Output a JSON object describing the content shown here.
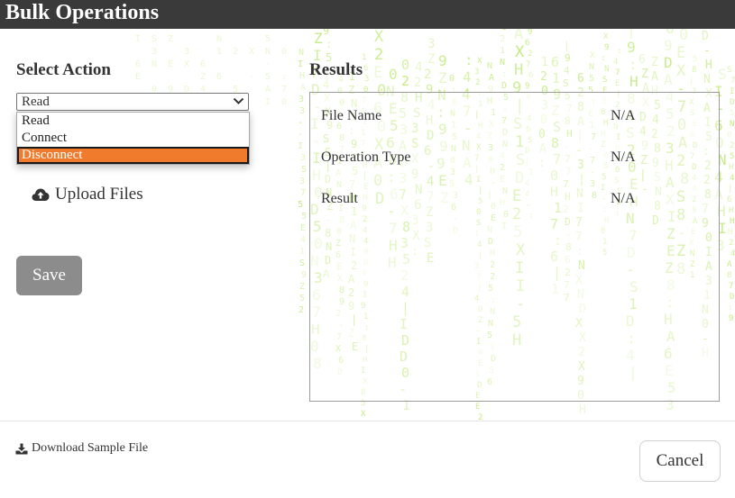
{
  "header": {
    "title": "Bulk Operations"
  },
  "select_action": {
    "heading": "Select Action",
    "selected_value": "Read",
    "options": [
      "Read",
      "Connect",
      "Disconnect"
    ],
    "highlighted_option": "Disconnect"
  },
  "upload": {
    "label": "Upload Files"
  },
  "save": {
    "label": "Save"
  },
  "results": {
    "heading": "Results",
    "rows": [
      {
        "label": "File Name",
        "value": "N/A"
      },
      {
        "label": "Operation Type",
        "value": "N/A"
      },
      {
        "label": "Result",
        "value": "N/A"
      }
    ]
  },
  "footer": {
    "download_label": "Download Sample File",
    "cancel_label": "Cancel"
  },
  "icons": {
    "upload": "cloud-upload-icon",
    "download": "download-icon",
    "dropdown": "chevron-down-icon"
  },
  "colors": {
    "header_bg": "#3a3a3a",
    "highlight": "#f07b2c",
    "save_button": "#8c8c8c",
    "matrix_text": "#b9e86a"
  }
}
